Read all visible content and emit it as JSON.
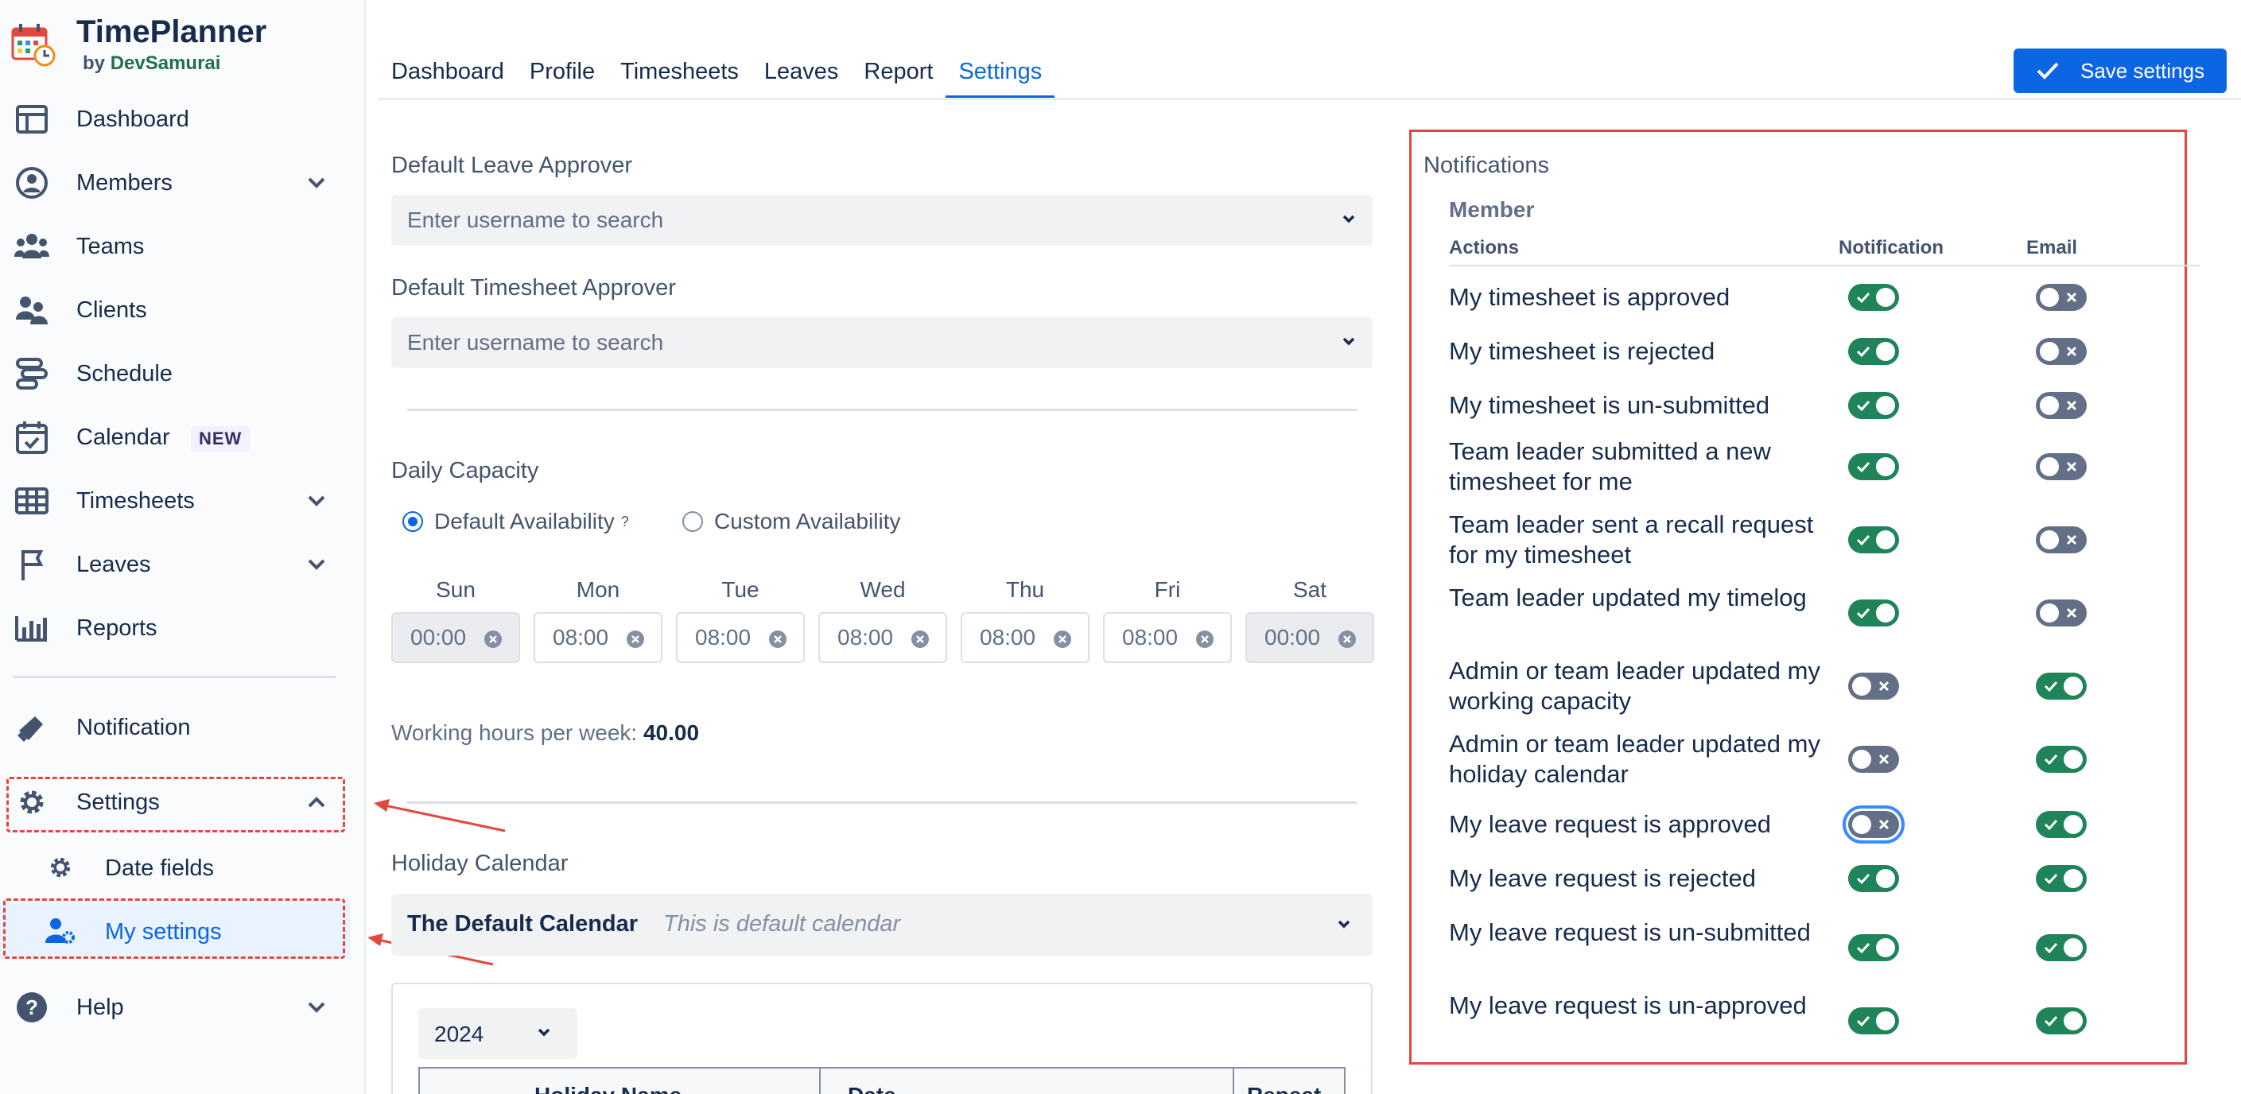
{
  "brand": {
    "name": "TimePlanner",
    "by": "by",
    "company": "DevSamurai"
  },
  "sidebar": {
    "items": [
      {
        "label": "Dashboard"
      },
      {
        "label": "Members"
      },
      {
        "label": "Teams"
      },
      {
        "label": "Clients"
      },
      {
        "label": "Schedule"
      },
      {
        "label": "Calendar",
        "badge": "NEW"
      },
      {
        "label": "Timesheets"
      },
      {
        "label": "Leaves"
      },
      {
        "label": "Reports"
      },
      {
        "label": "Notification"
      },
      {
        "label": "Settings"
      },
      {
        "label": "Date fields"
      },
      {
        "label": "My settings"
      },
      {
        "label": "Help"
      }
    ]
  },
  "tabs": [
    "Dashboard",
    "Profile",
    "Timesheets",
    "Leaves",
    "Report",
    "Settings"
  ],
  "active_tab": "Settings",
  "save_label": "Save settings",
  "form": {
    "leave_approver": {
      "label": "Default Leave Approver",
      "placeholder": "Enter username to search"
    },
    "timesheet_approver": {
      "label": "Default Timesheet Approver",
      "placeholder": "Enter username to search"
    },
    "capacity": {
      "label": "Daily Capacity",
      "option_default": "Default Availability",
      "option_default_hint": "?",
      "option_custom": "Custom Availability",
      "selected": "Default Availability",
      "days": [
        {
          "day": "Sun",
          "value": "00:00",
          "disabled": true
        },
        {
          "day": "Mon",
          "value": "08:00",
          "disabled": false
        },
        {
          "day": "Tue",
          "value": "08:00",
          "disabled": false
        },
        {
          "day": "Wed",
          "value": "08:00",
          "disabled": false
        },
        {
          "day": "Thu",
          "value": "08:00",
          "disabled": false
        },
        {
          "day": "Fri",
          "value": "08:00",
          "disabled": false
        },
        {
          "day": "Sat",
          "value": "00:00",
          "disabled": true
        }
      ],
      "hours_label": "Working hours per week:",
      "hours_value": "40.00"
    },
    "holiday": {
      "label": "Holiday Calendar",
      "calendar_name": "The Default Calendar",
      "calendar_desc": "This is default calendar",
      "year": "2024",
      "columns": [
        "Holiday Name",
        "Date",
        "Repeat"
      ]
    }
  },
  "notifications": {
    "title": "Notifications",
    "group": "Member",
    "columns": {
      "actions": "Actions",
      "notification": "Notification",
      "email": "Email"
    },
    "rows": [
      {
        "label": "My timesheet is approved",
        "notification": true,
        "email": false
      },
      {
        "label": "My timesheet is rejected",
        "notification": true,
        "email": false
      },
      {
        "label": "My timesheet is un-submitted",
        "notification": true,
        "email": false
      },
      {
        "label": "Team leader submitted a new timesheet for me",
        "notification": true,
        "email": false
      },
      {
        "label": "Team leader sent a recall request for my timesheet",
        "notification": true,
        "email": false
      },
      {
        "label": "Team leader updated my timelog",
        "notification": true,
        "email": false
      },
      {
        "label": "Admin or team leader updated my working capacity",
        "notification": false,
        "email": true
      },
      {
        "label": "Admin or team leader updated my holiday calendar",
        "notification": false,
        "email": true
      },
      {
        "label": "My leave request is approved",
        "notification": false,
        "email": true,
        "focused": true
      },
      {
        "label": "My leave request is rejected",
        "notification": true,
        "email": true
      },
      {
        "label": "My leave request is un-submitted",
        "notification": true,
        "email": true
      },
      {
        "label": "My leave request is un-approved",
        "notification": true,
        "email": true
      }
    ]
  },
  "colors": {
    "primary": "#0c66e4",
    "toggle_on": "#1f845a",
    "toggle_off": "#626f86",
    "highlight": "#e2483d"
  }
}
